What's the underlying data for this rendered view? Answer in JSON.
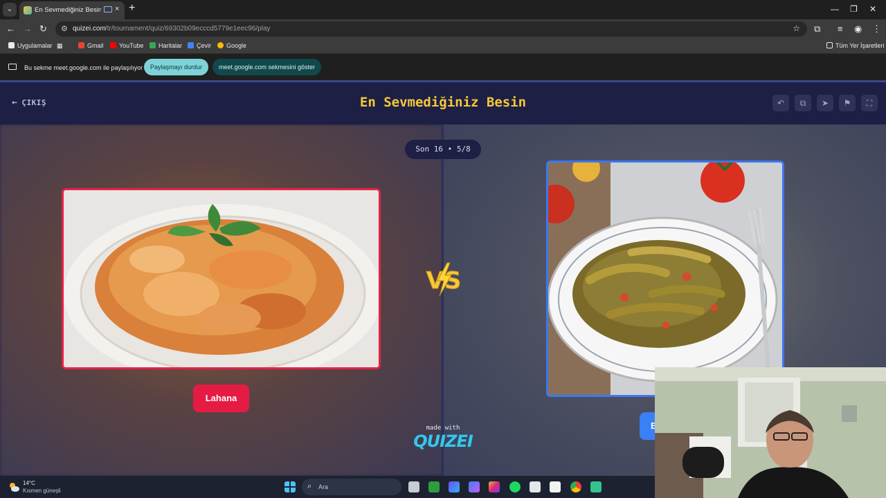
{
  "browser": {
    "tab_title": "En Sevmediğiniz Besin - Tie",
    "new_tab": "+",
    "tab_close": "×",
    "url_host": "quizei.com",
    "url_path": "/tr/tournament/quiz/69302b09ecccd5779e1eec96/play",
    "window_controls": [
      "—",
      "❐",
      "✕"
    ]
  },
  "bookmarks": {
    "items": [
      {
        "label": "Uygulamalar",
        "color": "#e8eaed"
      },
      {
        "label": "Gmail",
        "color": "#ea4335"
      },
      {
        "label": "YouTube",
        "color": "#ff0000"
      },
      {
        "label": "Haritalar",
        "color": "#34a853"
      },
      {
        "label": "Çevir",
        "color": "#4285f4"
      },
      {
        "label": "Google",
        "color": "#fbbc05"
      }
    ],
    "all_bookmarks": "Tüm Yer İşaretleri"
  },
  "sharing": {
    "message": "Bu sekme meet.google.com ile paylaşılıyor",
    "stop_label": "Paylaşmayı durdur",
    "show_label": "meet.google.com sekmesini göster"
  },
  "quiz": {
    "exit_label": "ÇIKIŞ",
    "title": "En Sevmediğiniz Besin",
    "round": "Son 16 • 5/8",
    "left_option": "Lahana",
    "right_option": "B",
    "vs_text": "VS",
    "made_with": "made with",
    "brand": "QUIZEI",
    "accent_color": "#f5c93a",
    "left_color": "#e51b43",
    "right_color": "#3a80f6"
  },
  "taskbar": {
    "temperature": "14°C",
    "weather": "Kısmen güneşli",
    "search_label": "Ara"
  }
}
